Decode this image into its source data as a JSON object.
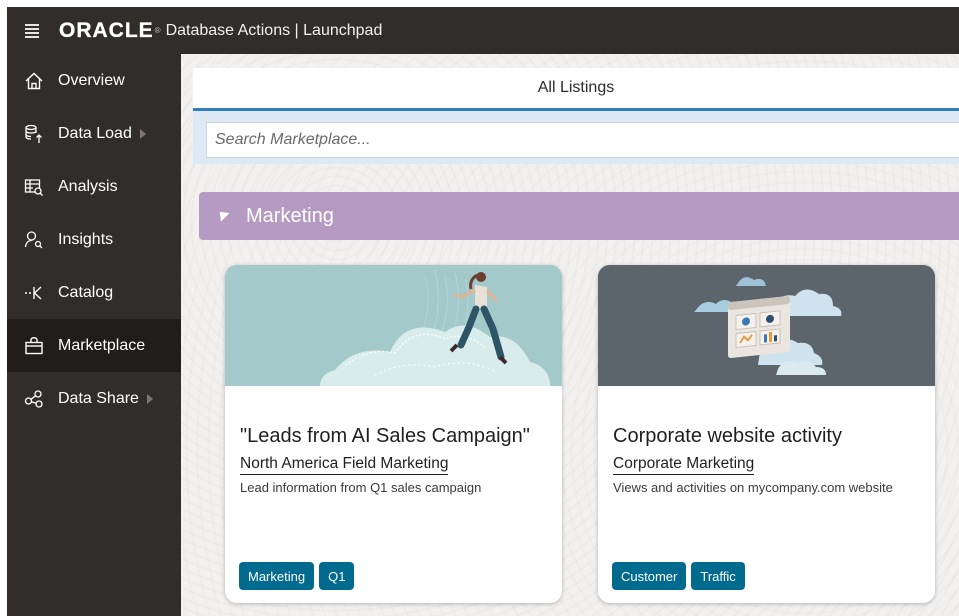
{
  "topbar": {
    "logo": "ORACLE",
    "logo_mark": "®",
    "title": "Database Actions | Launchpad"
  },
  "sidebar": {
    "items": [
      {
        "label": "Overview",
        "icon": "home-icon"
      },
      {
        "label": "Data Load",
        "icon": "database-upload-icon",
        "has_submenu": true
      },
      {
        "label": "Analysis",
        "icon": "table-search-icon"
      },
      {
        "label": "Insights",
        "icon": "person-search-icon"
      },
      {
        "label": "Catalog",
        "icon": "catalog-icon"
      },
      {
        "label": "Marketplace",
        "icon": "shopping-bag-icon",
        "active": true
      },
      {
        "label": "Data Share",
        "icon": "share-icon",
        "has_submenu": true
      }
    ]
  },
  "main": {
    "header": "All Listings",
    "search_placeholder": "Search Marketplace...",
    "category": "Marketing",
    "cards": [
      {
        "title": "\"Leads from AI Sales Campaign\"",
        "subtitle": "North America Field Marketing",
        "description": "Lead information from Q1 sales campaign",
        "tags": [
          "Marketing",
          "Q1"
        ],
        "image": "woman-running-illustration"
      },
      {
        "title": "Corporate website activity",
        "subtitle": "Corporate Marketing",
        "description": "Views and activities on mycompany.com website",
        "tags": [
          "Customer",
          "Traffic"
        ],
        "image": "cloud-dashboard-illustration"
      }
    ]
  },
  "colors": {
    "sidebar_bg": "#312d2a",
    "category_bar": "#b59bc1",
    "tag": "#006b8f",
    "header_underline": "#2f7fc1"
  }
}
